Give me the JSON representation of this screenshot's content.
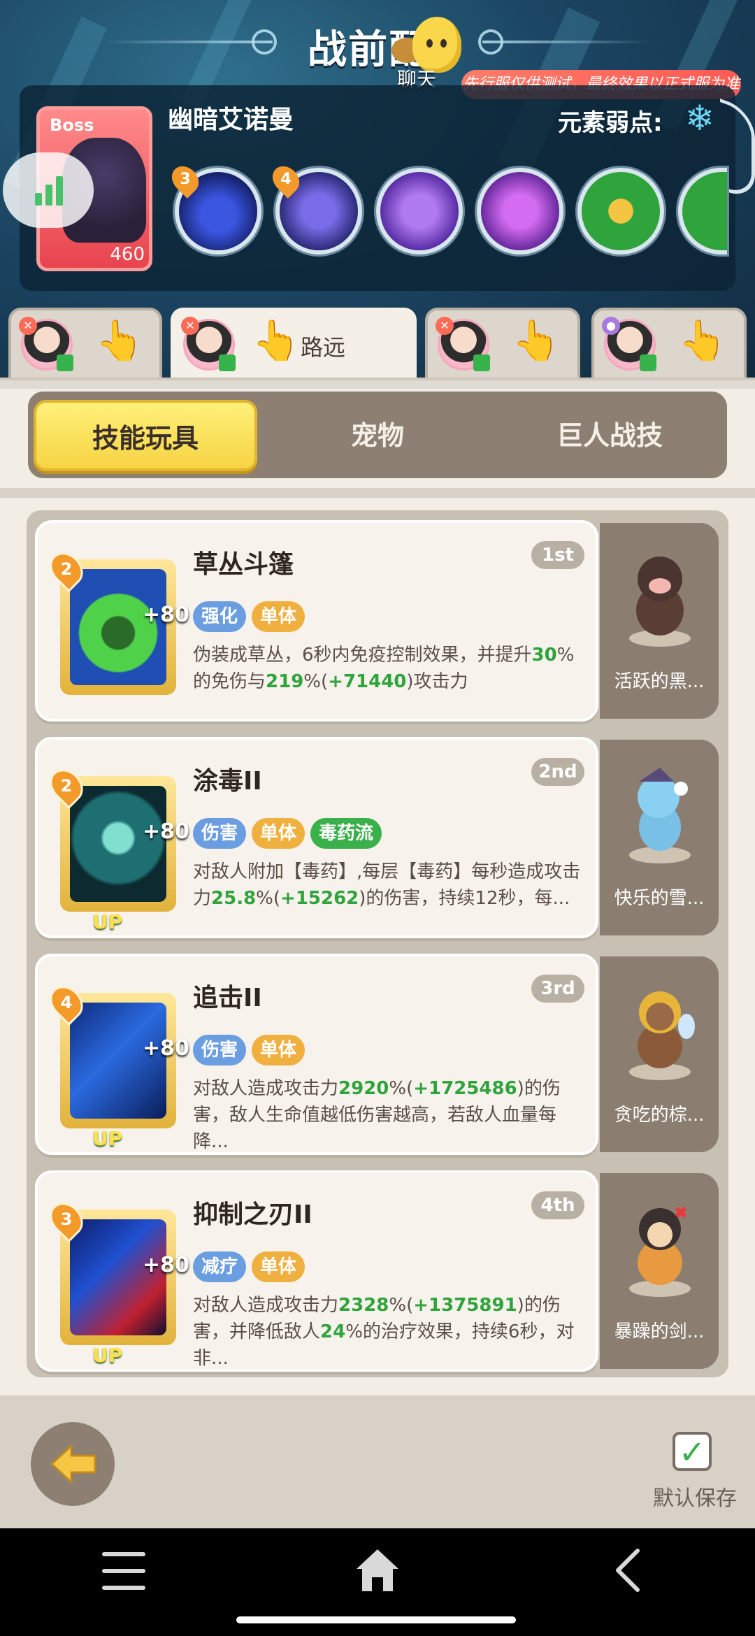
{
  "header": {
    "title": "战前配",
    "chat_label": "聊天",
    "test_notice": "先行服仅供测试，最终效果以正式服为准"
  },
  "boss": {
    "badge": "Boss",
    "level": "460",
    "name": "幽暗艾诺曼",
    "weakness_label": "元素弱点:",
    "weakness_icon": "snowflake-icon",
    "skill_orbs": [
      {
        "icon": "dark-claw-orb-icon",
        "level": "3"
      },
      {
        "icon": "shadow-arrow-orb-icon",
        "level": "4"
      },
      {
        "icon": "purple-drop-orb-icon",
        "level": ""
      },
      {
        "icon": "purple-slime-orb-icon",
        "level": ""
      },
      {
        "icon": "hourglass-orb-icon",
        "level": ""
      }
    ]
  },
  "character_tabs": [
    {
      "label": ""
    },
    {
      "label": "路远"
    },
    {
      "label": ""
    },
    {
      "label": ""
    }
  ],
  "segments": {
    "skills": "技能玩具",
    "pets": "宠物",
    "giant": "巨人战技"
  },
  "skills": [
    {
      "level": "2",
      "plus": "+80",
      "up": "",
      "name": "草丛斗篷",
      "rank": "1st",
      "tags": [
        "强化",
        "单体"
      ],
      "desc_parts": [
        "伪装成草丛，6秒内免疫控制效果，并提升",
        "30",
        "%的免伤与",
        "219",
        "%(",
        "+71440",
        ")攻击力"
      ]
    },
    {
      "level": "2",
      "plus": "+80",
      "up": "UP",
      "name": "涂毒II",
      "rank": "2nd",
      "tags": [
        "伤害",
        "单体",
        "毒药流"
      ],
      "desc_parts": [
        "对敌人附加【毒药】,每层【毒药】每秒造成攻击力",
        "25.8",
        "%(",
        "+15262",
        ")的伤害，持续12秒，每..."
      ]
    },
    {
      "level": "4",
      "plus": "+80",
      "up": "UP",
      "name": "追击II",
      "rank": "3rd",
      "tags": [
        "伤害",
        "单体"
      ],
      "desc_parts": [
        "对敌人造成攻击力",
        "2920",
        "%(",
        "+1725486",
        ")的伤害，敌人生命值越低伤害越高，若敌人血量每降..."
      ]
    },
    {
      "level": "3",
      "plus": "+80",
      "up": "UP",
      "name": "抑制之刃II",
      "rank": "4th",
      "tags": [
        "减疗",
        "单体"
      ],
      "desc_parts": [
        "对敌人造成攻击力",
        "2328",
        "%(",
        "+1375891",
        ")的伤害，并降低敌人",
        "24",
        "%的治疗效果，持续6秒，对非..."
      ]
    }
  ],
  "pets": [
    {
      "name": "活跃的黑..."
    },
    {
      "name": "快乐的雪..."
    },
    {
      "name": "贪吃的棕..."
    },
    {
      "name": "暴躁的剑..."
    }
  ],
  "footer": {
    "save_label": "默认保存"
  },
  "colors": {
    "accent_yellow": "#f6d443",
    "highlight_green": "#2fa33c",
    "boss_red": "#e8444f",
    "tag_blue": "#6b9ee0",
    "tag_orange": "#f0b040",
    "tag_green": "#39b04a"
  }
}
